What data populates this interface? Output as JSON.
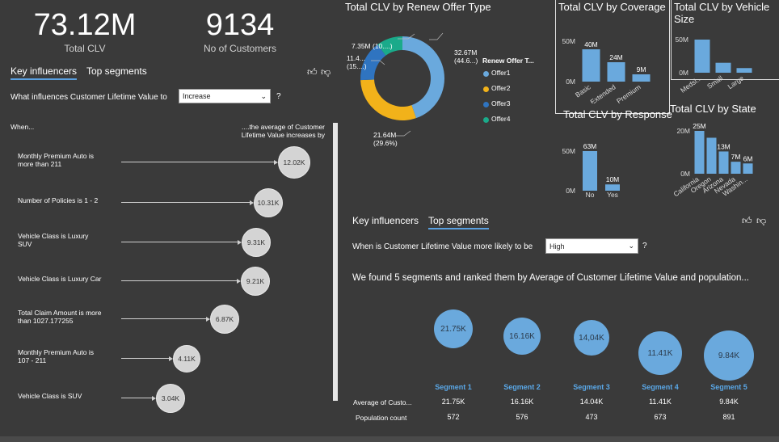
{
  "kpis": [
    {
      "value": "73.12M",
      "label": "Total CLV"
    },
    {
      "value": "9134",
      "label": "No of Customers"
    }
  ],
  "left_panel": {
    "tabs": [
      "Key influencers",
      "Top segments"
    ],
    "question": "What influences Customer Lifetime Value to",
    "dropdown_value": "Increase",
    "help": "?",
    "when_header": "When...",
    "avg_header_line1": "....the average of Customer",
    "avg_header_line2": "Lifetime Value increases by",
    "influencers": [
      {
        "label1": "Monthly Premium Auto is",
        "label2": "more than 211",
        "value": "12.02K"
      },
      {
        "label1": "Number of Policies is 1 - 2",
        "label2": "",
        "value": "10.31K"
      },
      {
        "label1": "Vehicle Class is Luxury",
        "label2": "SUV",
        "value": "9.31K"
      },
      {
        "label1": "Vehicle Class is Luxury Car",
        "label2": "",
        "value": "9.21K"
      },
      {
        "label1": "Total Claim Amount is more",
        "label2": "than 1027.177255",
        "value": "6.87K"
      },
      {
        "label1": "Monthly Premium Auto is",
        "label2": "107 - 211",
        "value": "4.11K"
      },
      {
        "label1": "Vehicle Class is SUV",
        "label2": "",
        "value": "3.04K"
      }
    ]
  },
  "donut": {
    "title": "Total CLV by Renew Offer Type",
    "legend_title": "Renew Offer T...",
    "labels": {
      "offer1_a": "32.67M",
      "offer1_b": "(44.6...)",
      "offer2_a": "21.64M",
      "offer2_b": "(29.6%)",
      "offer3_a": "11.4...",
      "offer3_b": "(15....)",
      "offer4_a": "7.35M (10....)"
    },
    "legend": [
      "Offer1",
      "Offer2",
      "Offer3",
      "Offer4"
    ],
    "colors": [
      "#6aa9dd",
      "#f2b21a",
      "#2f74c0",
      "#1aaa8a"
    ]
  },
  "chart_data": [
    {
      "type": "pie",
      "title": "Total CLV by Renew Offer Type",
      "categories": [
        "Offer1",
        "Offer2",
        "Offer3",
        "Offer4"
      ],
      "values": [
        32.67,
        21.64,
        11.4,
        7.35
      ],
      "unit": "M"
    },
    {
      "type": "bar",
      "title": "Total CLV by Coverage",
      "categories": [
        "Basic",
        "Extended",
        "Premium"
      ],
      "values": [
        40,
        24,
        9
      ],
      "data_labels": [
        "40M",
        "24M",
        "9M"
      ],
      "yticks": [
        "50M",
        "0M"
      ],
      "ylim": [
        0,
        50
      ]
    },
    {
      "type": "bar",
      "title": "Total CLV by Vehicle Size",
      "categories": [
        "Medsi...",
        "Small",
        "Large"
      ],
      "values": [
        51,
        15,
        7
      ],
      "yticks": [
        "50M",
        "0M"
      ],
      "ylim": [
        0,
        50
      ]
    },
    {
      "type": "bar",
      "title": "Total CLV by Response",
      "categories": [
        "No",
        "Yes"
      ],
      "values": [
        63,
        10
      ],
      "data_labels": [
        "63M",
        "10M"
      ],
      "yticks": [
        "50M",
        "0M"
      ],
      "ylim": [
        0,
        63
      ]
    },
    {
      "type": "bar",
      "title": "Total CLV by State",
      "categories": [
        "California",
        "Oregon",
        "Arizona",
        "Nevada",
        "Washin..."
      ],
      "values": [
        25,
        21,
        13,
        7,
        6
      ],
      "data_labels": [
        "25M",
        "",
        "13M",
        "7M",
        "6M"
      ],
      "yticks": [
        "20M",
        "0M"
      ],
      "ylim": [
        0,
        25
      ]
    }
  ],
  "right_panel": {
    "tabs": [
      "Key influencers",
      "Top segments"
    ],
    "question": "When is Customer Lifetime Value more likely to be",
    "dropdown_value": "High",
    "help": "?",
    "summary": "We found 5 segments and ranked them by Average of Customer Lifetime Value and population...",
    "row_avg_label": "Average of Custo...",
    "row_pop_label": "Population count",
    "segments": [
      {
        "name": "Segment 1",
        "bubble": "21.75K",
        "avg": "21.75K",
        "pop": "572"
      },
      {
        "name": "Segment 2",
        "bubble": "16.16K",
        "avg": "16.16K",
        "pop": "576"
      },
      {
        "name": "Segment 3",
        "bubble": "14,04K",
        "avg": "14.04K",
        "pop": "473"
      },
      {
        "name": "Segment 4",
        "bubble": "11.41K",
        "avg": "11.41K",
        "pop": "673"
      },
      {
        "name": "Segment 5",
        "bubble": "9.84K",
        "avg": "9.84K",
        "pop": "891"
      }
    ]
  }
}
